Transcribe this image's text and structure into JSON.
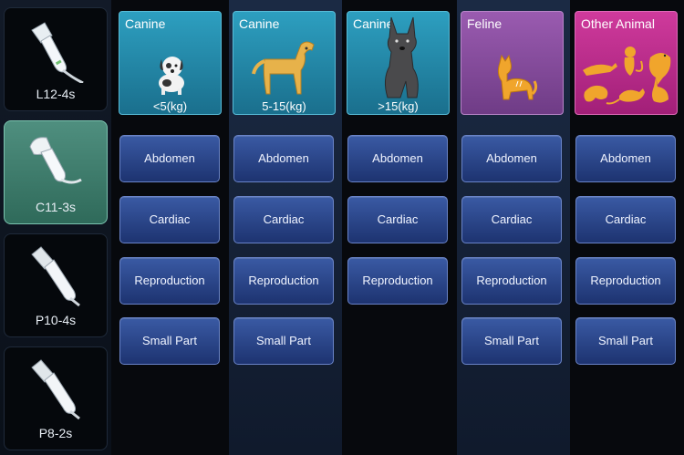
{
  "probes": [
    {
      "label": "L12-4s",
      "selected": false
    },
    {
      "label": "C11-3s",
      "selected": true
    },
    {
      "label": "P10-4s",
      "selected": false
    },
    {
      "label": "P8-2s",
      "selected": false
    }
  ],
  "columns": [
    {
      "title": "Canine",
      "weight": "<5(kg)",
      "buttons": [
        "Abdomen",
        "Cardiac",
        "Reproduction",
        "Small Part"
      ]
    },
    {
      "title": "Canine",
      "weight": "5-15(kg)",
      "buttons": [
        "Abdomen",
        "Cardiac",
        "Reproduction",
        "Small Part"
      ]
    },
    {
      "title": "Canine",
      "weight": ">15(kg)",
      "buttons": [
        "Abdomen",
        "Cardiac",
        "Reproduction"
      ]
    },
    {
      "title": "Feline",
      "weight": "",
      "buttons": [
        "Abdomen",
        "Cardiac",
        "Reproduction",
        "Small Part"
      ]
    },
    {
      "title": "Other Animal",
      "weight": "",
      "buttons": [
        "Abdomen",
        "Cardiac",
        "Reproduction",
        "Small Part"
      ]
    }
  ],
  "colors": {
    "canine_header": "#1f86a8",
    "feline_header": "#8a4ca2",
    "other_header": "#c0288c",
    "button": "#2a4488",
    "selected_probe": "#3f7d6d"
  }
}
